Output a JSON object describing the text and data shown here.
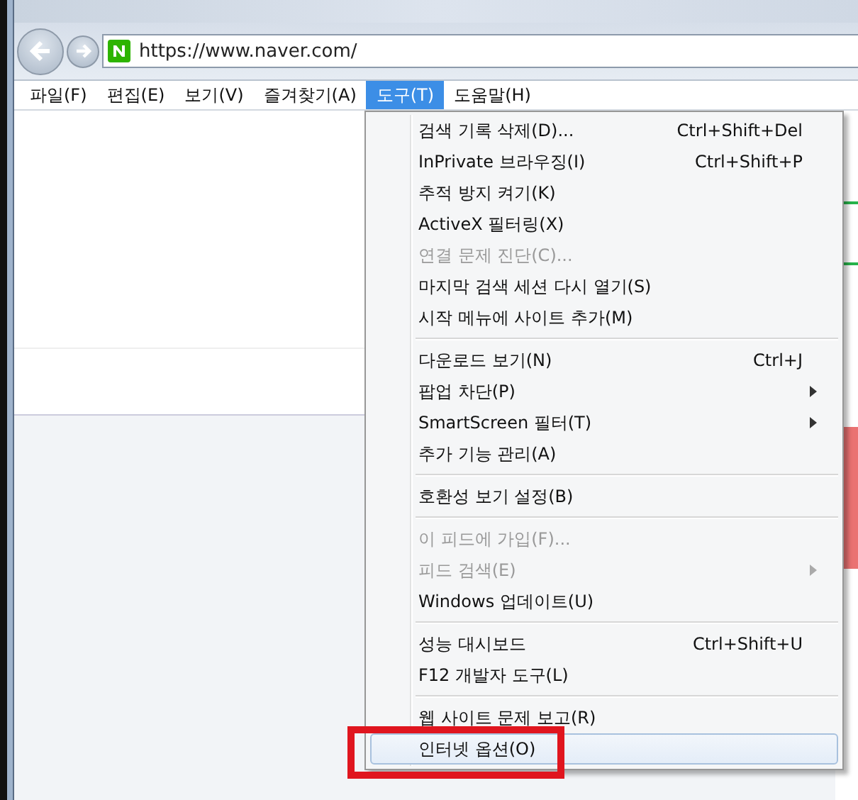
{
  "address_bar": {
    "url": "https://www.naver.com/"
  },
  "menu_bar": [
    {
      "label": "파일(F)",
      "selected": false
    },
    {
      "label": "편집(E)",
      "selected": false
    },
    {
      "label": "보기(V)",
      "selected": false
    },
    {
      "label": "즐겨찾기(A)",
      "selected": false
    },
    {
      "label": "도구(T)",
      "selected": true
    },
    {
      "label": "도움말(H)",
      "selected": false
    }
  ],
  "tools_menu": [
    [
      {
        "label": "검색 기록 삭제(D)...",
        "shortcut": "Ctrl+Shift+Del",
        "disabled": false,
        "submenu": false,
        "selected": false
      },
      {
        "label": "InPrivate 브라우징(I)",
        "shortcut": "Ctrl+Shift+P",
        "disabled": false,
        "submenu": false,
        "selected": false
      },
      {
        "label": "추적 방지 켜기(K)",
        "disabled": false,
        "submenu": false,
        "selected": false
      },
      {
        "label": "ActiveX 필터링(X)",
        "disabled": false,
        "submenu": false,
        "selected": false
      },
      {
        "label": "연결 문제 진단(C)...",
        "disabled": true,
        "submenu": false,
        "selected": false
      },
      {
        "label": "마지막 검색 세션 다시 열기(S)",
        "disabled": false,
        "submenu": false,
        "selected": false
      },
      {
        "label": "시작 메뉴에 사이트 추가(M)",
        "disabled": false,
        "submenu": false,
        "selected": false
      }
    ],
    [
      {
        "label": "다운로드 보기(N)",
        "shortcut": "Ctrl+J",
        "disabled": false,
        "submenu": false,
        "selected": false
      },
      {
        "label": "팝업 차단(P)",
        "disabled": false,
        "submenu": true,
        "selected": false
      },
      {
        "label": "SmartScreen 필터(T)",
        "disabled": false,
        "submenu": true,
        "selected": false
      },
      {
        "label": "추가 기능 관리(A)",
        "disabled": false,
        "submenu": false,
        "selected": false
      }
    ],
    [
      {
        "label": "호환성 보기 설정(B)",
        "disabled": false,
        "submenu": false,
        "selected": false
      }
    ],
    [
      {
        "label": "이 피드에 가입(F)...",
        "disabled": true,
        "submenu": false,
        "selected": false
      },
      {
        "label": "피드 검색(E)",
        "disabled": true,
        "submenu": true,
        "selected": false
      },
      {
        "label": "Windows 업데이트(U)",
        "disabled": false,
        "submenu": false,
        "selected": false
      }
    ],
    [
      {
        "label": "성능 대시보드",
        "shortcut": "Ctrl+Shift+U",
        "disabled": false,
        "submenu": false,
        "selected": false
      },
      {
        "label": "F12 개발자 도구(L)",
        "disabled": false,
        "submenu": false,
        "selected": false
      }
    ],
    [
      {
        "label": "웹 사이트 문제 보고(R)",
        "disabled": false,
        "submenu": false,
        "selected": false
      },
      {
        "label": "인터넷 옵션(O)",
        "disabled": false,
        "submenu": false,
        "selected": true
      }
    ]
  ]
}
